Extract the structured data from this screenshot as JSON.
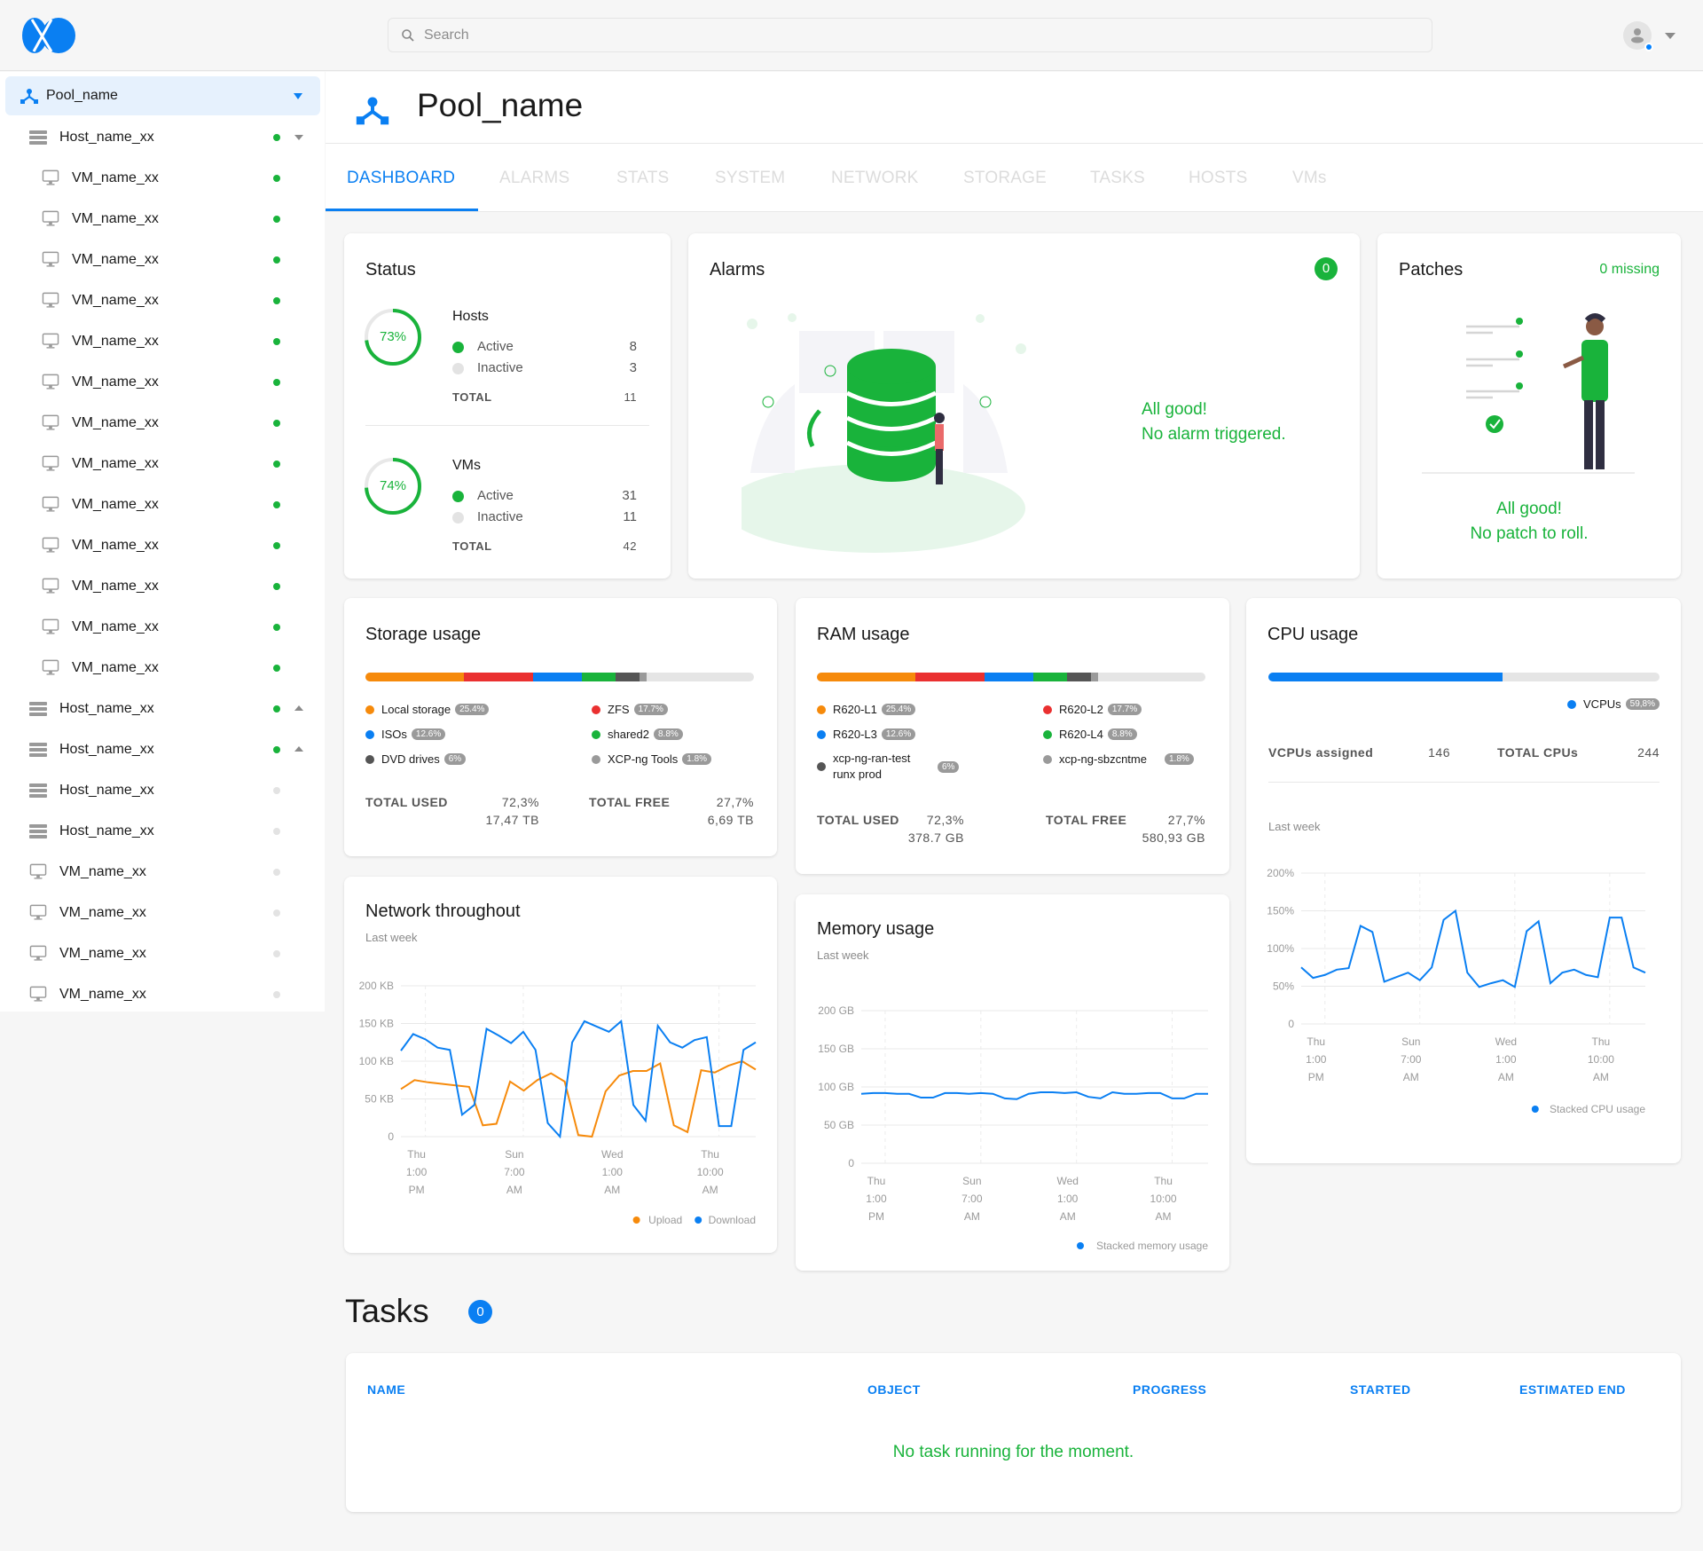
{
  "header": {
    "search_placeholder": "Search"
  },
  "sidebar": {
    "pool": {
      "label": "Pool_name"
    },
    "items": [
      {
        "type": "host",
        "label": "Host_name_xx",
        "status": "active",
        "caret": "down",
        "indent": 1
      },
      {
        "type": "vm",
        "label": "VM_name_xx",
        "status": "active",
        "indent": 2
      },
      {
        "type": "vm",
        "label": "VM_name_xx",
        "status": "active",
        "indent": 2
      },
      {
        "type": "vm",
        "label": "VM_name_xx",
        "status": "active",
        "indent": 2
      },
      {
        "type": "vm",
        "label": "VM_name_xx",
        "status": "active",
        "indent": 2
      },
      {
        "type": "vm",
        "label": "VM_name_xx",
        "status": "active",
        "indent": 2
      },
      {
        "type": "vm",
        "label": "VM_name_xx",
        "status": "active",
        "indent": 2
      },
      {
        "type": "vm",
        "label": "VM_name_xx",
        "status": "active",
        "indent": 2
      },
      {
        "type": "vm",
        "label": "VM_name_xx",
        "status": "active",
        "indent": 2
      },
      {
        "type": "vm",
        "label": "VM_name_xx",
        "status": "active",
        "indent": 2
      },
      {
        "type": "vm",
        "label": "VM_name_xx",
        "status": "active",
        "indent": 2
      },
      {
        "type": "vm",
        "label": "VM_name_xx",
        "status": "active",
        "indent": 2
      },
      {
        "type": "vm",
        "label": "VM_name_xx",
        "status": "active",
        "indent": 2
      },
      {
        "type": "vm",
        "label": "VM_name_xx",
        "status": "active",
        "indent": 2
      },
      {
        "type": "host",
        "label": "Host_name_xx",
        "status": "active",
        "caret": "up",
        "indent": 1
      },
      {
        "type": "host",
        "label": "Host_name_xx",
        "status": "active",
        "caret": "up",
        "indent": 1
      },
      {
        "type": "host",
        "label": "Host_name_xx",
        "status": "inactive",
        "indent": 1
      },
      {
        "type": "host",
        "label": "Host_name_xx",
        "status": "inactive",
        "indent": 1
      },
      {
        "type": "vm",
        "label": "VM_name_xx",
        "status": "inactive",
        "indent": 1
      },
      {
        "type": "vm",
        "label": "VM_name_xx",
        "status": "inactive",
        "indent": 1
      },
      {
        "type": "vm",
        "label": "VM_name_xx",
        "status": "inactive",
        "indent": 1
      },
      {
        "type": "vm",
        "label": "VM_name_xx",
        "status": "inactive",
        "indent": 1
      }
    ]
  },
  "page": {
    "title": "Pool_name"
  },
  "tabs": [
    "DASHBOARD",
    "ALARMS",
    "STATS",
    "SYSTEM",
    "NETWORK",
    "STORAGE",
    "TASKS",
    "HOSTS",
    "VMs"
  ],
  "colors": {
    "accent": "#0a7ff2",
    "success": "#19b33b",
    "orange": "#f68a0b",
    "red": "#ea3030",
    "blue": "#0a7ff2",
    "green": "#19b33b",
    "dark": "#555555",
    "gray": "#9a9a9a",
    "track": "#e5e5e5"
  },
  "status": {
    "title": "Status",
    "hosts": {
      "title": "Hosts",
      "percent_label": "73%",
      "percent": 73,
      "active_label": "Active",
      "active": "8",
      "inactive_label": "Inactive",
      "inactive": "3",
      "total_label": "TOTAL",
      "total": "11"
    },
    "vms": {
      "title": "VMs",
      "percent_label": "74%",
      "percent": 74,
      "active_label": "Active",
      "active": "31",
      "inactive_label": "Inactive",
      "inactive": "11",
      "total_label": "TOTAL",
      "total": "42"
    }
  },
  "alarms": {
    "title": "Alarms",
    "count": "0",
    "message_line1": "All good!",
    "message_line2": "No alarm triggered."
  },
  "patches": {
    "title": "Patches",
    "missing": "0 missing",
    "message_line1": "All good!",
    "message_line2": "No patch to roll."
  },
  "storage": {
    "title": "Storage usage",
    "segments": [
      {
        "label": "Local storage",
        "pct_label": "25.4%",
        "pct": 25.4,
        "color": "#f68a0b"
      },
      {
        "label": "ZFS",
        "pct_label": "17.7%",
        "pct": 17.7,
        "color": "#ea3030"
      },
      {
        "label": "ISOs",
        "pct_label": "12.6%",
        "pct": 12.6,
        "color": "#0a7ff2"
      },
      {
        "label": "shared2",
        "pct_label": "8.8%",
        "pct": 8.8,
        "color": "#19b33b"
      },
      {
        "label": "DVD drives",
        "pct_label": "6%",
        "pct": 6,
        "color": "#555555"
      },
      {
        "label": "XCP-ng Tools",
        "pct_label": "1.8%",
        "pct": 1.8,
        "color": "#9a9a9a"
      }
    ],
    "total_used_label": "TOTAL USED",
    "total_used_pct": "72,3%",
    "total_used": "17,47 TB",
    "total_free_label": "TOTAL FREE",
    "total_free_pct": "27,7%",
    "total_free": "6,69 TB"
  },
  "ram": {
    "title": "RAM usage",
    "segments": [
      {
        "label": "R620-L1",
        "pct_label": "25.4%",
        "pct": 25.4,
        "color": "#f68a0b"
      },
      {
        "label": "R620-L2",
        "pct_label": "17.7%",
        "pct": 17.7,
        "color": "#ea3030"
      },
      {
        "label": "R620-L3",
        "pct_label": "12.6%",
        "pct": 12.6,
        "color": "#0a7ff2"
      },
      {
        "label": "R620-L4",
        "pct_label": "8.8%",
        "pct": 8.8,
        "color": "#19b33b"
      },
      {
        "label": "xcp-ng-ran-test runx prod",
        "pct_label": "6%",
        "pct": 6,
        "color": "#555555"
      },
      {
        "label": "xcp-ng-sbzcntme",
        "pct_label": "1.8%",
        "pct": 1.8,
        "color": "#9a9a9a"
      }
    ],
    "total_used_label": "TOTAL USED",
    "total_used_pct": "72,3%",
    "total_used": "378.7 GB",
    "total_free_label": "TOTAL FREE",
    "total_free_pct": "27,7%",
    "total_free": "580,93 GB"
  },
  "cpu": {
    "title": "CPU usage",
    "vcpus_label": "VCPUs",
    "vcpus_pct_label": "59,8%",
    "vcpus_pct": 59.8,
    "assigned_label": "VCPUs assigned",
    "assigned": "146",
    "total_label": "TOTAL CPUs",
    "total": "244",
    "subtitle": "Last week"
  },
  "network": {
    "title": "Network throughout",
    "subtitle": "Last week"
  },
  "memory": {
    "title": "Memory usage",
    "subtitle": "Last week"
  },
  "tasks": {
    "title": "Tasks",
    "count": "0",
    "columns": [
      "NAME",
      "OBJECT",
      "PROGRESS",
      "STARTED",
      "ESTIMATED END"
    ],
    "empty_message": "No task running for the moment."
  },
  "chart_data": [
    {
      "id": "network",
      "type": "line",
      "title": "Network throughout",
      "subtitle": "Last week",
      "xlabel": "",
      "ylabel": "",
      "yticks": [
        "0",
        "50 KB",
        "100 KB",
        "150 KB",
        "200 KB"
      ],
      "ylim": [
        0,
        200
      ],
      "xticks": [
        [
          "Thu",
          "1:00",
          "PM"
        ],
        [
          "Sun",
          "7:00",
          "AM"
        ],
        [
          "Wed",
          "1:00",
          "AM"
        ],
        [
          "Thu",
          "10:00",
          "AM"
        ]
      ],
      "xtick_positions": [
        2,
        10,
        18,
        26
      ],
      "series": [
        {
          "name": "Upload",
          "color": "#f68a0b",
          "values": [
            63,
            75,
            72,
            70,
            68,
            66,
            15,
            17,
            73,
            61,
            75,
            84,
            73,
            2,
            0,
            60,
            81,
            87,
            87,
            97,
            15,
            6,
            88,
            85,
            94,
            100,
            89
          ]
        },
        {
          "name": "Download",
          "color": "#0a7ff2",
          "values": [
            114,
            136,
            129,
            118,
            115,
            29,
            42,
            143,
            134,
            124,
            139,
            115,
            18,
            0,
            125,
            153,
            146,
            139,
            153,
            42,
            21,
            147,
            125,
            118,
            128,
            132,
            14,
            14,
            115,
            125
          ]
        }
      ],
      "legend": "bottom-right",
      "grid": true
    },
    {
      "id": "memory",
      "type": "line",
      "title": "Memory usage",
      "subtitle": "Last week",
      "yticks": [
        "0",
        "50 GB",
        "100 GB",
        "150 GB",
        "200 GB"
      ],
      "ylim": [
        0,
        200
      ],
      "xticks": [
        [
          "Thu",
          "1:00",
          "PM"
        ],
        [
          "Sun",
          "7:00",
          "AM"
        ],
        [
          "Wed",
          "1:00",
          "AM"
        ],
        [
          "Thu",
          "10:00",
          "AM"
        ]
      ],
      "xtick_positions": [
        2,
        10,
        18,
        26
      ],
      "series": [
        {
          "name": "Stacked memory usage",
          "color": "#0a7ff2",
          "values": [
            91,
            92,
            92,
            91,
            91,
            86,
            86,
            92,
            92,
            91,
            92,
            91,
            85,
            84,
            91,
            93,
            93,
            92,
            93,
            87,
            85,
            93,
            91,
            91,
            92,
            92,
            85,
            85,
            91,
            91
          ]
        }
      ],
      "legend": "bottom-right",
      "grid": true
    },
    {
      "id": "cpu",
      "type": "line",
      "title": "CPU usage",
      "subtitle": "Last week",
      "yticks": [
        "0",
        "50%",
        "100%",
        "150%",
        "200%"
      ],
      "ylim": [
        0,
        200
      ],
      "xticks": [
        [
          "Thu",
          "1:00",
          "PM"
        ],
        [
          "Sun",
          "7:00",
          "AM"
        ],
        [
          "Wed",
          "1:00",
          "AM"
        ],
        [
          "Thu",
          "10:00",
          "AM"
        ]
      ],
      "xtick_positions": [
        2,
        10,
        18,
        26
      ],
      "series": [
        {
          "name": "Stacked CPU usage",
          "color": "#0a7ff2",
          "values": [
            75,
            61,
            65,
            72,
            74,
            130,
            122,
            56,
            62,
            68,
            58,
            75,
            138,
            150,
            68,
            49,
            54,
            58,
            49,
            123,
            136,
            54,
            68,
            72,
            65,
            62,
            141,
            141,
            75,
            68
          ]
        }
      ],
      "legend": "bottom-right",
      "grid": true
    }
  ]
}
